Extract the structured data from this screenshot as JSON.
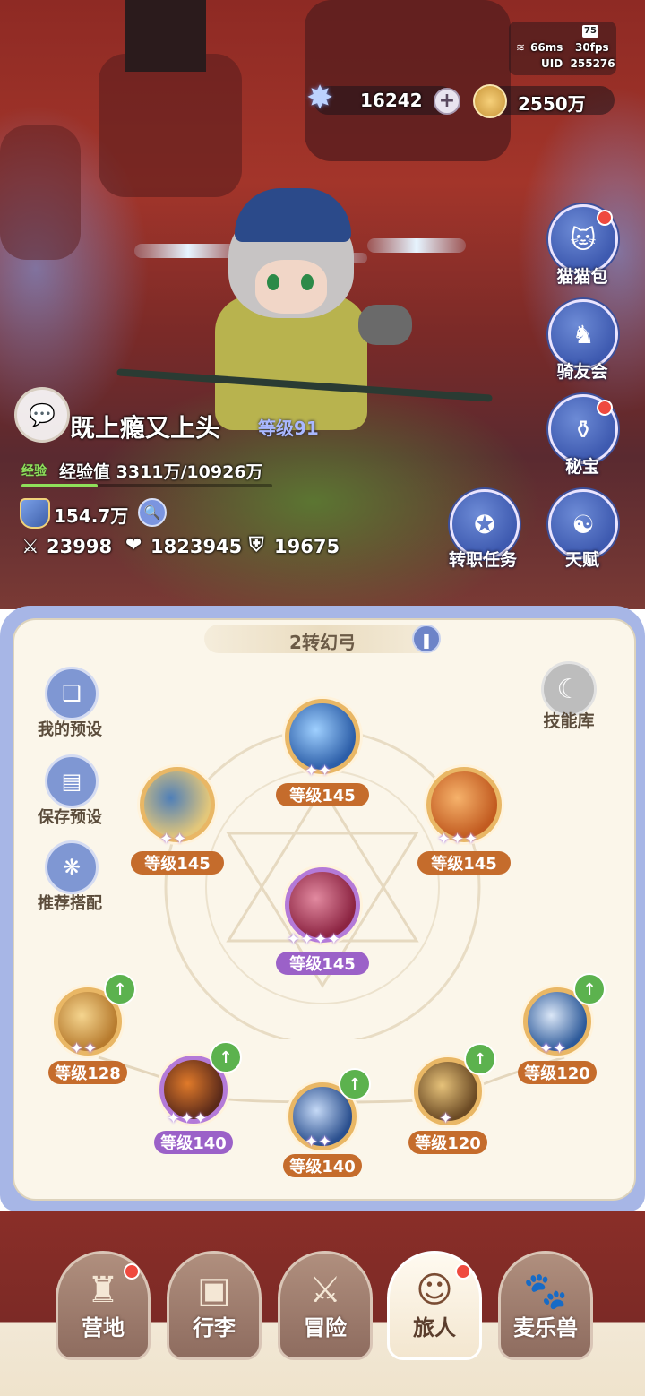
{
  "status": {
    "battery": "75",
    "ping": "66ms",
    "fps": "30fps",
    "uid": "UID  255276"
  },
  "currency": {
    "gems": "16242",
    "gold": "2550万",
    "add_symbol": "+"
  },
  "side_buttons": [
    {
      "label": "猫猫包",
      "icon": "cat-bag-icon",
      "red_dot": true
    },
    {
      "label": "骑友会",
      "icon": "horse-icon",
      "red_dot": false
    },
    {
      "label": "秘宝",
      "icon": "treasure-icon",
      "red_dot": true
    },
    {
      "label": "转职任务",
      "icon": "job-quest-icon",
      "red_dot": false
    },
    {
      "label": "天赋",
      "icon": "talent-icon",
      "red_dot": false
    }
  ],
  "player": {
    "name": "既上瘾又上头",
    "level": "等级91",
    "exp_tag": "经验",
    "exp_text": "经验值 3311万/10926万",
    "exp_progress": 0.303,
    "power": "154.7万",
    "attack": "23998",
    "hp": "1823945",
    "defense": "19675"
  },
  "panel": {
    "class_title": "2转幻弓",
    "skill_lib": "技能库",
    "presets": [
      {
        "label": "我的预设",
        "icon": "cards-icon"
      },
      {
        "label": "保存预设",
        "icon": "save-icon"
      },
      {
        "label": "推荐搭配",
        "icon": "recommend-icon"
      }
    ],
    "skills": [
      {
        "level": "等级145",
        "stars": 2,
        "color": "orange",
        "upgradable": false
      },
      {
        "level": "等级145",
        "stars": 2,
        "color": "orange",
        "upgradable": false
      },
      {
        "level": "等级145",
        "stars": 3,
        "color": "orange",
        "upgradable": false
      },
      {
        "level": "等级145",
        "stars": 4,
        "color": "purple",
        "upgradable": false
      },
      {
        "level": "等级128",
        "stars": 2,
        "color": "orange",
        "upgradable": true
      },
      {
        "level": "等级140",
        "stars": 3,
        "color": "purple",
        "upgradable": true
      },
      {
        "level": "等级140",
        "stars": 2,
        "color": "orange",
        "upgradable": true
      },
      {
        "level": "等级120",
        "stars": 1,
        "color": "orange",
        "upgradable": true
      },
      {
        "level": "等级120",
        "stars": 2,
        "color": "orange",
        "upgradable": true
      }
    ]
  },
  "nav": [
    {
      "label": "营地",
      "icon": "castle-icon",
      "red_dot": true
    },
    {
      "label": "行李",
      "icon": "backpack-icon",
      "red_dot": false
    },
    {
      "label": "冒险",
      "icon": "crossed-swords-icon",
      "red_dot": false
    },
    {
      "label": "旅人",
      "icon": "traveler-icon",
      "red_dot": true,
      "active": true
    },
    {
      "label": "麦乐兽",
      "icon": "pet-icon",
      "red_dot": false
    }
  ]
}
